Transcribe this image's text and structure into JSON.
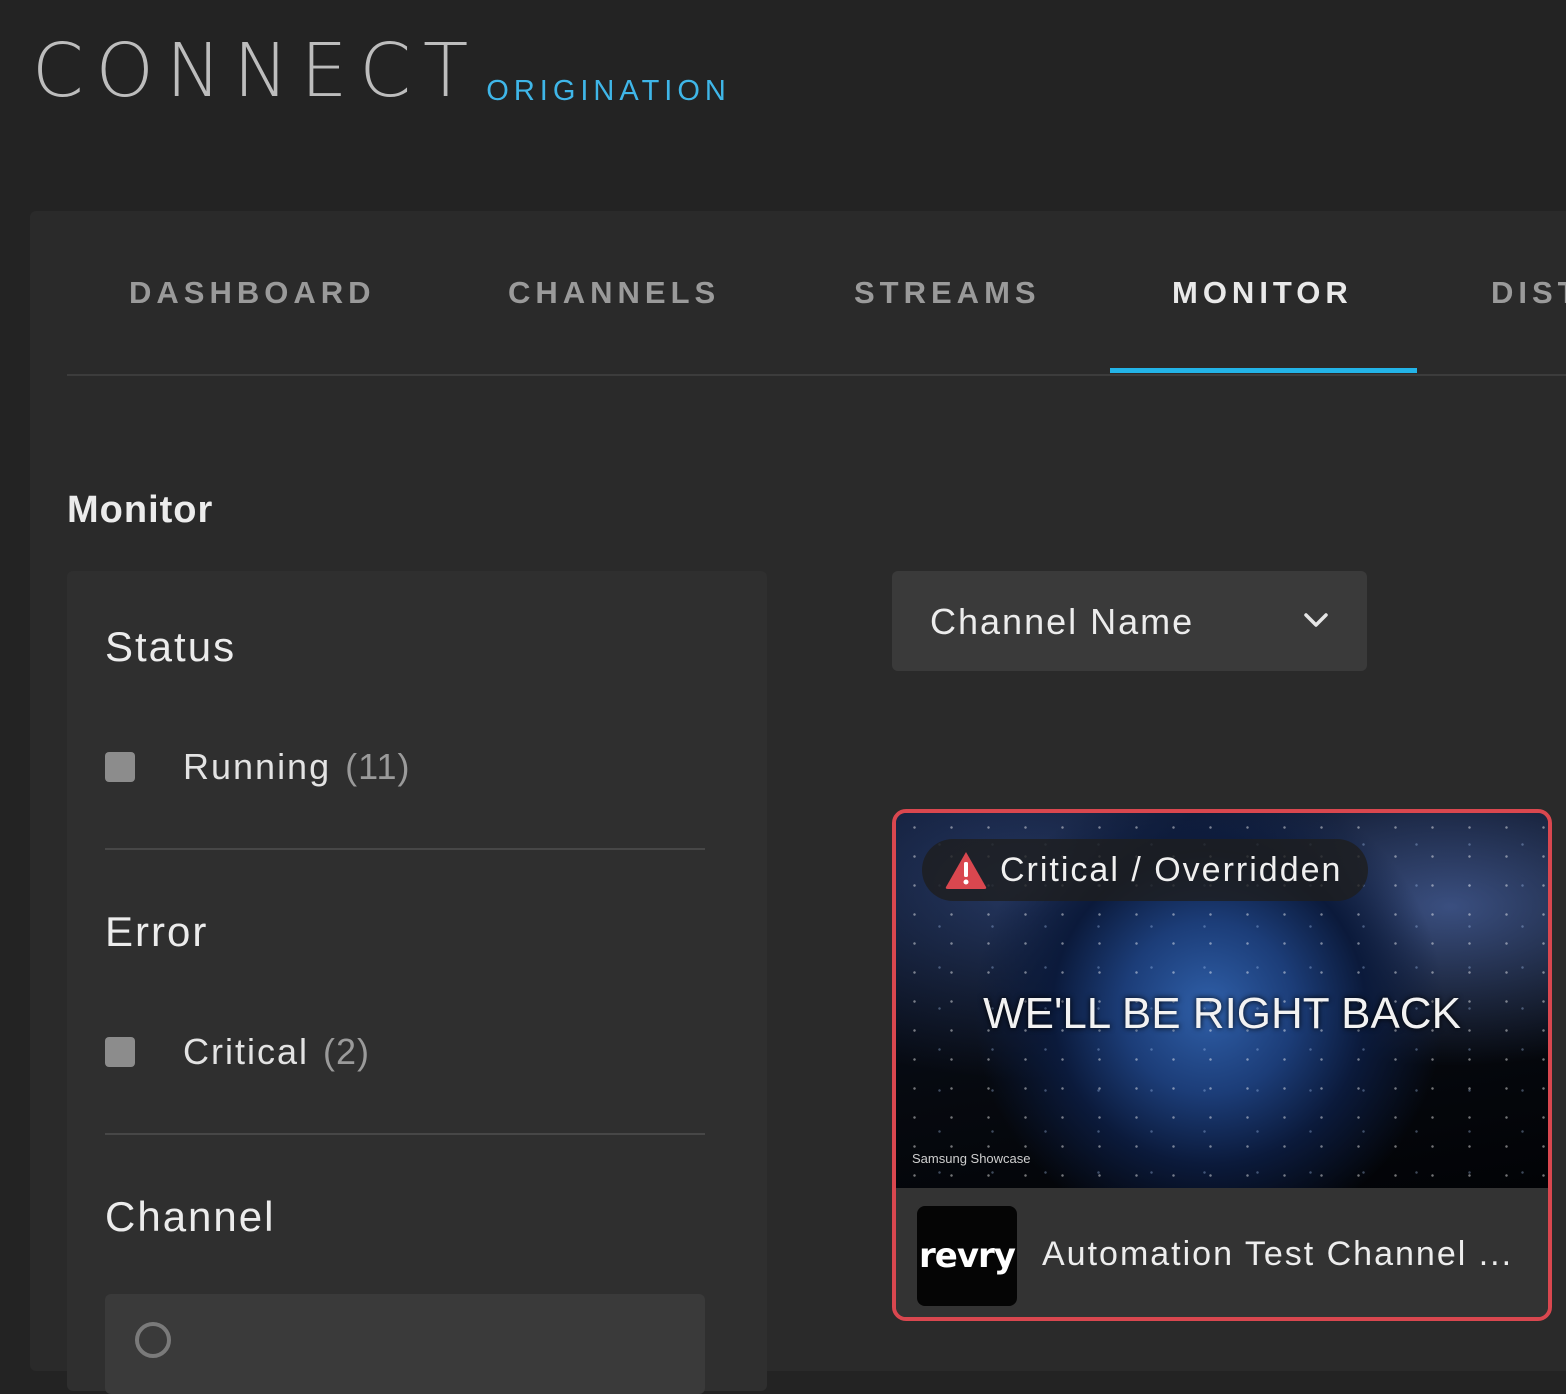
{
  "brand": {
    "name": "CONNECT",
    "product": "ORIGINATION"
  },
  "nav": {
    "tabs": [
      {
        "label": "DASHBOARD"
      },
      {
        "label": "CHANNELS"
      },
      {
        "label": "STREAMS"
      },
      {
        "label": "MONITOR",
        "active": true
      },
      {
        "label": "DIST"
      }
    ]
  },
  "page": {
    "title": "Monitor"
  },
  "filters": {
    "status": {
      "heading": "Status",
      "options": [
        {
          "label": "Running",
          "count": "(11)"
        }
      ]
    },
    "error": {
      "heading": "Error",
      "options": [
        {
          "label": "Critical",
          "count": "(2)"
        }
      ]
    },
    "channel": {
      "heading": "Channel",
      "search_icon": "search-icon"
    }
  },
  "sort": {
    "selected": "Channel Name",
    "icon": "chevron-down-icon"
  },
  "channels": [
    {
      "status_label": "Critical / Overridden",
      "status_icon": "warning-icon",
      "status_color": "#d9474f",
      "slate_text": "WE'LL BE RIGHT BACK",
      "watermark": "Samsung Showcase",
      "logo_text": "revry",
      "name": "Automation Test Channel ..."
    }
  ],
  "colors": {
    "accent": "#23b4e8",
    "critical": "#d9474f",
    "brand_sub": "#3fb6e8"
  }
}
